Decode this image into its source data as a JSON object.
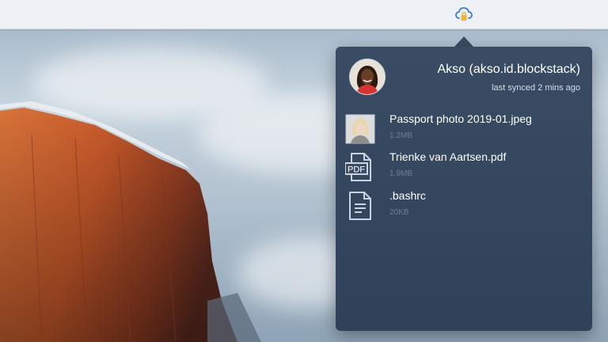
{
  "menubar": {
    "app_icon": "cloud-lock-icon"
  },
  "popover": {
    "user": {
      "name": "Akso (akso.id.blockstack)",
      "sync_status": "last synced 2 mins ago",
      "avatar_icon": "user-avatar"
    },
    "files": [
      {
        "name": "Passport photo 2019-01.jpeg",
        "size": "1.2MB",
        "icon": "image-thumbnail-icon"
      },
      {
        "name": "Trienke van Aartsen.pdf",
        "size": "1.9MB",
        "icon": "pdf-file-icon",
        "icon_text": "PDF"
      },
      {
        "name": ".bashrc",
        "size": "20KB",
        "icon": "text-file-icon"
      }
    ]
  },
  "colors": {
    "menubar": "#eef1f5",
    "popover_bg": "#394c63",
    "lock_accent": "#f0b432",
    "cloud_accent": "#3a7bd5",
    "muted_text": "#6d7f93"
  }
}
